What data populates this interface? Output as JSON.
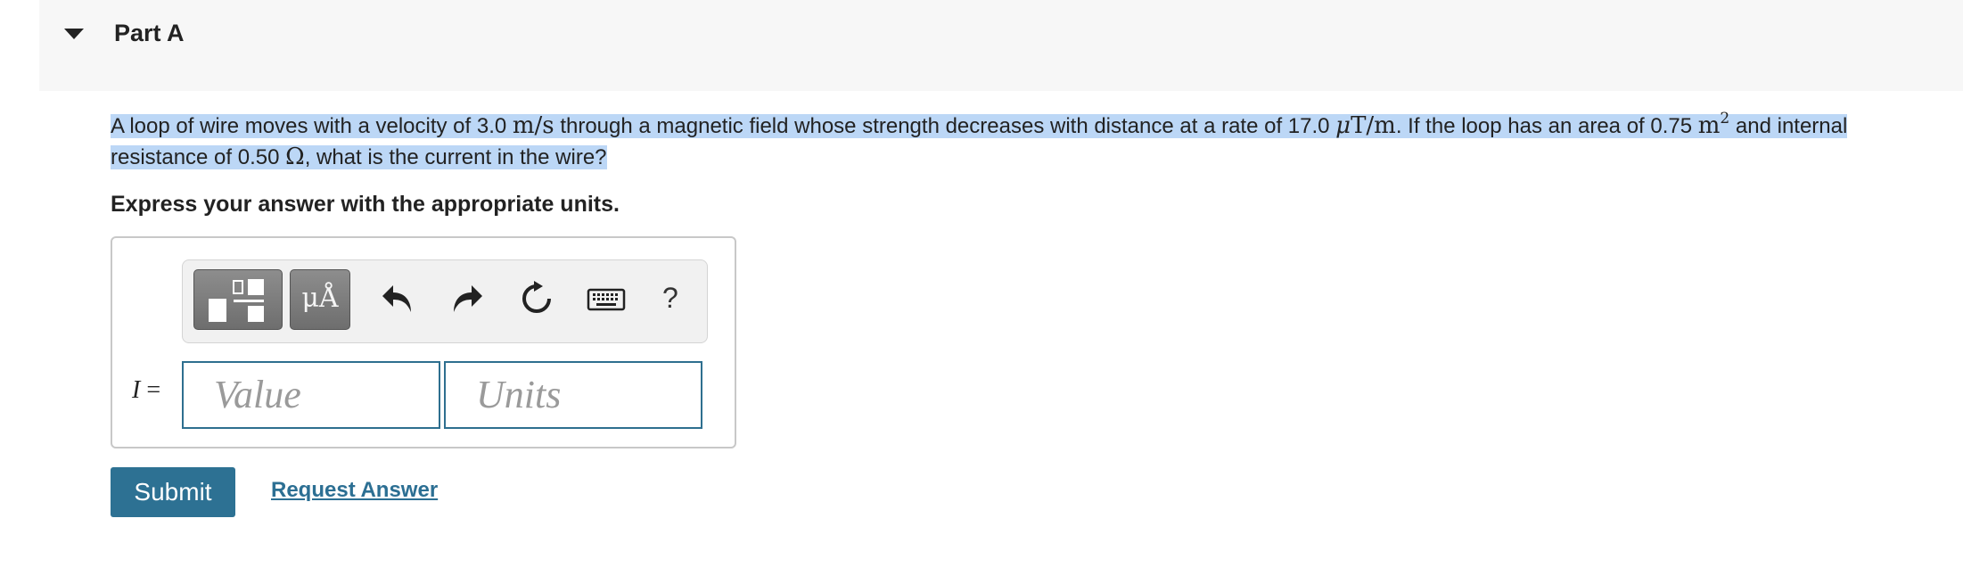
{
  "part": {
    "title": "Part A",
    "caret_icon": "caret-down-icon"
  },
  "question": {
    "t1": "A loop of wire moves with a velocity of 3.0 ",
    "u1": "m/s",
    "t2": " through a magnetic field whose strength decreases with distance at a rate of 17.0 ",
    "u2_mu": "μ",
    "u2_rest": "T/m",
    "t3": ". If the loop has an area of 0.75 ",
    "u3": "m",
    "u3_exp": "2",
    "t4": " and internal resistance of 0.50 ",
    "u4": "Ω",
    "t5": ", what is the current in the wire?"
  },
  "instruction": "Express your answer with the appropriate units.",
  "toolbar": {
    "templates_icon": "templates-icon",
    "units_label": "μÅ",
    "undo_icon": "undo-icon",
    "redo_icon": "redo-icon",
    "reset_icon": "reset-icon",
    "keyboard_icon": "keyboard-icon",
    "help_label": "?"
  },
  "answer": {
    "variable": "I",
    "equals": " =",
    "value_placeholder": "Value",
    "units_placeholder": "Units"
  },
  "actions": {
    "submit_label": "Submit",
    "request_label": "Request Answer"
  },
  "colors": {
    "accent": "#2d7193",
    "highlight": "#bcd7f6",
    "field_border": "#2e6f8f"
  }
}
